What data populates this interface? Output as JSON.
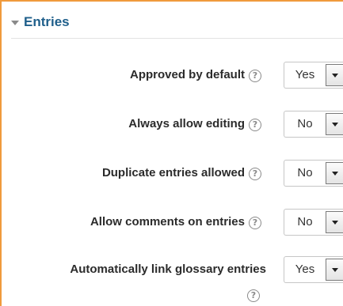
{
  "section": {
    "legend": "Entries",
    "colors": {
      "frame_border": "#f09a3c",
      "legend_text": "#1f5f8b"
    }
  },
  "settings": [
    {
      "label": "Approved by default",
      "value": "Yes",
      "help_icon": "question-circle-icon"
    },
    {
      "label": "Always allow editing",
      "value": "No",
      "help_icon": "question-circle-icon"
    },
    {
      "label": "Duplicate entries allowed",
      "value": "No",
      "help_icon": "question-circle-icon"
    },
    {
      "label": "Allow comments on entries",
      "value": "No",
      "help_icon": "question-circle-icon"
    },
    {
      "label": "Automatically link glossary entries",
      "value": "Yes",
      "help_icon": "question-circle-icon"
    }
  ]
}
